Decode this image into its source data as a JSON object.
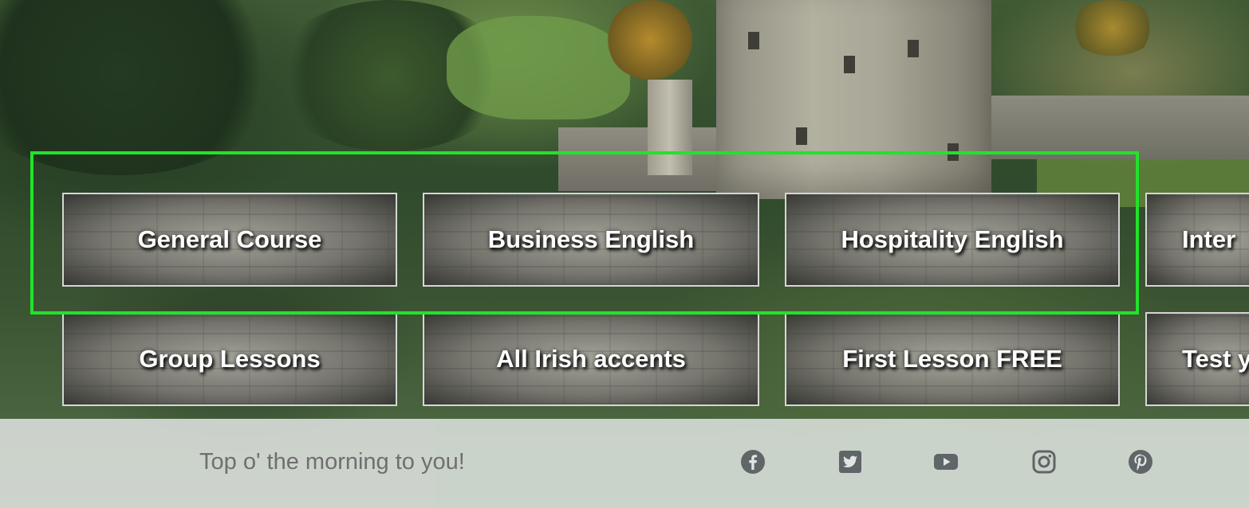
{
  "buttons": {
    "row1": [
      "General Course",
      "Business English",
      "Hospitality English",
      "Inter"
    ],
    "row2": [
      "Group Lessons",
      "All Irish accents",
      "First Lesson FREE",
      "Test y"
    ]
  },
  "footer": {
    "tagline": "Top o' the morning to you!",
    "social_icons": [
      "facebook-icon",
      "twitter-icon",
      "youtube-icon",
      "instagram-icon",
      "pinterest-icon"
    ]
  },
  "colors": {
    "highlight": "#22e32a",
    "icon": "#5f6668",
    "tagline": "#6f6f6f"
  }
}
